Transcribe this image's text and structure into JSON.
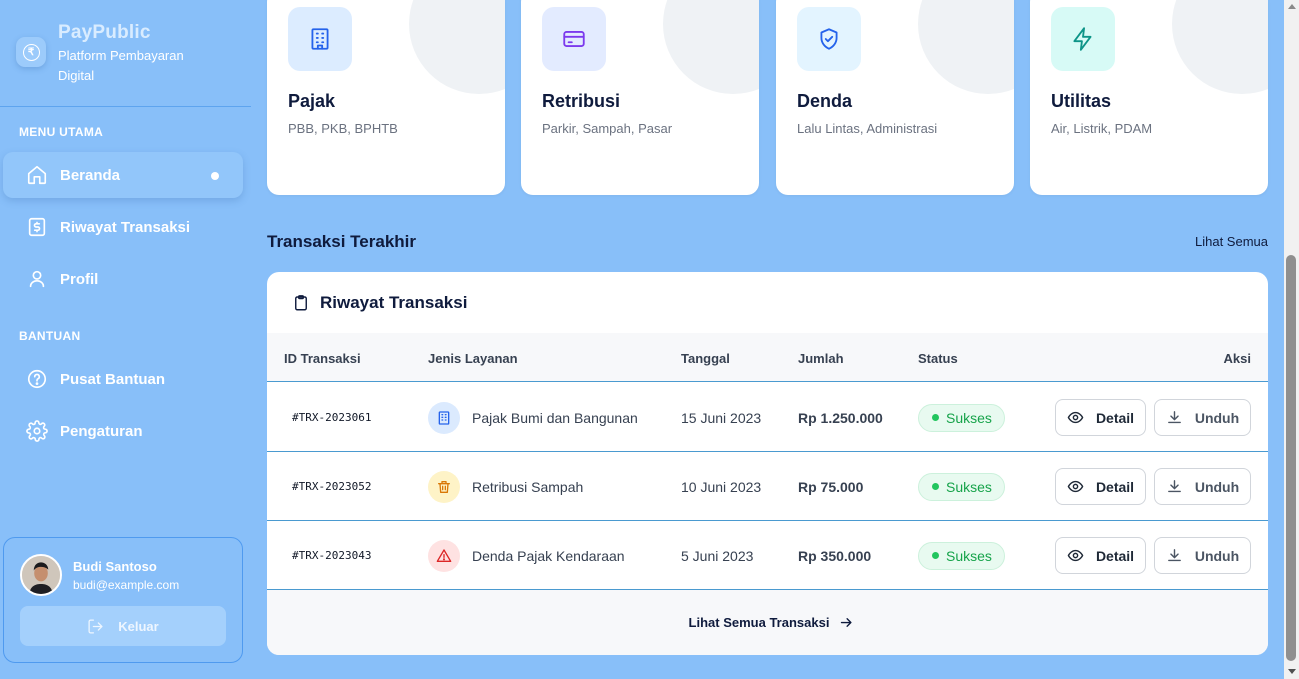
{
  "brand": {
    "name": "PayPublic",
    "subtitle": "Platform Pembayaran Digital"
  },
  "sidebar": {
    "main_section": "MENU UTAMA",
    "help_section": "BANTUAN",
    "items": [
      {
        "label": "Beranda",
        "icon": "home-icon",
        "active": true
      },
      {
        "label": "Riwayat Transaksi",
        "icon": "receipt-icon"
      },
      {
        "label": "Profil",
        "icon": "user-icon"
      },
      {
        "label": "Pusat Bantuan",
        "icon": "help-circle-icon"
      },
      {
        "label": "Pengaturan",
        "icon": "gear-icon"
      }
    ]
  },
  "user": {
    "name": "Budi Santoso",
    "email": "budi@example.com",
    "logout_label": "Keluar"
  },
  "categories": [
    {
      "title": "Pajak",
      "desc": "PBB, PKB, BPHTB",
      "icon": "building-icon",
      "color": "#2563eb",
      "bg": "#dcecff"
    },
    {
      "title": "Retribusi",
      "desc": "Parkir, Sampah, Pasar",
      "icon": "card-icon",
      "color": "#7c3aed",
      "bg": "#e3ebff"
    },
    {
      "title": "Denda",
      "desc": "Lalu Lintas, Administrasi",
      "icon": "shield-check-icon",
      "color": "#2563eb",
      "bg": "#e3f4ff"
    },
    {
      "title": "Utilitas",
      "desc": "Air, Listrik, PDAM",
      "icon": "lightning-icon",
      "color": "#0d9488",
      "bg": "#d7faf6"
    }
  ],
  "recent": {
    "title": "Transaksi Terakhir",
    "see_all": "Lihat Semua"
  },
  "table": {
    "title": "Riwayat Transaksi",
    "columns": [
      "ID Transaksi",
      "Jenis Layanan",
      "Tanggal",
      "Jumlah",
      "Status",
      "Aksi"
    ],
    "rows": [
      {
        "id": "#TRX-2023061",
        "service": "Pajak Bumi dan Bangunan",
        "service_icon": "building-icon",
        "icon_color": "#2563eb",
        "icon_bg": "#dbeafe",
        "date": "15 Juni 2023",
        "amount": "Rp 1.250.000",
        "status": "Sukses"
      },
      {
        "id": "#TRX-2023052",
        "service": "Retribusi Sampah",
        "service_icon": "trash-icon",
        "icon_color": "#d97706",
        "icon_bg": "#fef3c7",
        "date": "10 Juni 2023",
        "amount": "Rp 75.000",
        "status": "Sukses"
      },
      {
        "id": "#TRX-2023043",
        "service": "Denda Pajak Kendaraan",
        "service_icon": "warning-icon",
        "icon_color": "#dc2626",
        "icon_bg": "#fee2e2",
        "date": "5 Juni 2023",
        "amount": "Rp 350.000",
        "status": "Sukses"
      }
    ],
    "detail_label": "Detail",
    "download_label": "Unduh",
    "footer_link": "Lihat Semua Transaksi"
  }
}
